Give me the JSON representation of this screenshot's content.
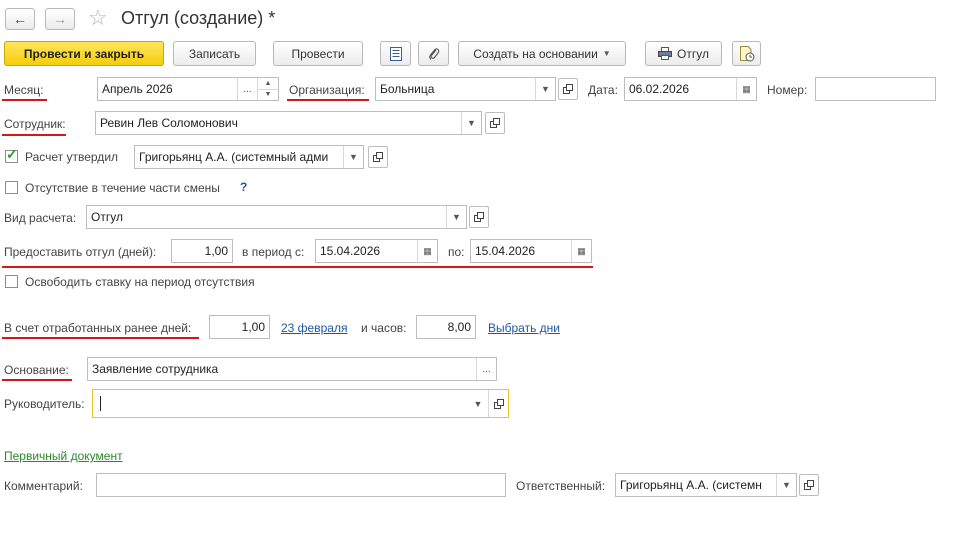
{
  "window": {
    "title": "Отгул (создание) *"
  },
  "toolbar": {
    "post_and_close": "Провести и закрыть",
    "save": "Записать",
    "post": "Провести",
    "create_based_on": "Создать на основании",
    "print_label": "Отгул"
  },
  "form": {
    "month_label": "Месяц:",
    "month_value": "Апрель 2026",
    "organization_label": "Организация:",
    "organization_value": "Больница",
    "date_label": "Дата:",
    "date_value": "06.02.2026",
    "number_label": "Номер:",
    "number_value": "",
    "employee_label": "Сотрудник:",
    "employee_value": "Ревин Лев Соломонович",
    "approved_label": "Расчет утвердил",
    "approved_value": "Григорьянц А.А. (системный адми",
    "partial_shift_label": "Отсутствие в течение части смены",
    "partial_shift_help": "?",
    "calc_type_label": "Вид расчета:",
    "calc_type_value": "Отгул",
    "days_label": "Предоставить отгул (дней):",
    "days_value": "1,00",
    "period_from_label": "в период с:",
    "period_from_value": "15.04.2026",
    "period_to_label": "по:",
    "period_to_value": "15.04.2026",
    "release_rate_label": "Освободить ставку на период отсутствия",
    "worked_days_label": "В счет отработанных ранее дней:",
    "worked_days_value": "1,00",
    "worked_date_link": "23 февраля",
    "hours_label": "и часов:",
    "hours_value": "8,00",
    "select_days_link": "Выбрать дни",
    "basis_label": "Основание:",
    "basis_value": "Заявление сотрудника",
    "manager_label": "Руководитель:",
    "manager_value": "",
    "primary_doc_link": "Первичный документ",
    "comment_label": "Комментарий:",
    "comment_value": "",
    "responsible_label": "Ответственный:",
    "responsible_value": "Григорьянц А.А. (системн"
  },
  "colors": {
    "primary_button": "#f5cd0b",
    "required_underline": "#d7161b",
    "link": "#1d57a6",
    "active_field_border": "#f0c230",
    "check_mark": "#2e9a2e"
  }
}
